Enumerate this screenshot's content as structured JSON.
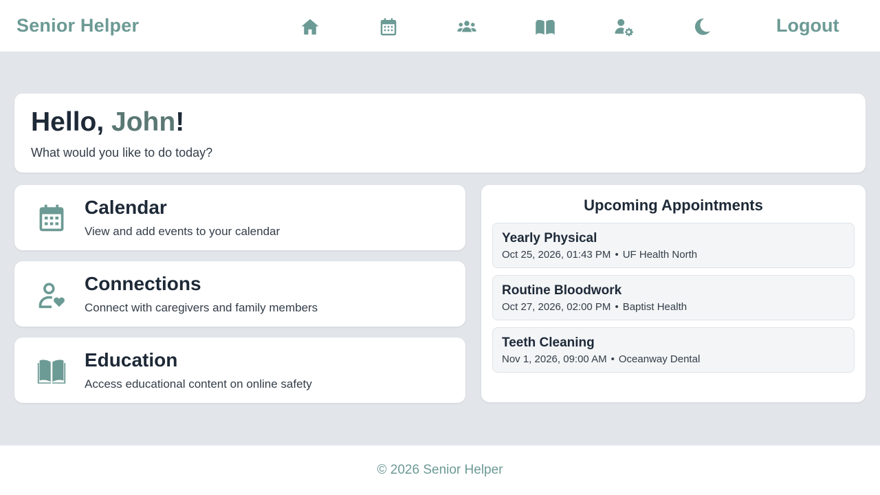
{
  "header": {
    "brand": "Senior Helper",
    "nav_icons": [
      "home-icon",
      "calendar-icon",
      "users-icon",
      "book-icon",
      "user-gear-icon",
      "moon-icon"
    ],
    "logout_label": "Logout"
  },
  "greeting": {
    "hello": "Hello, ",
    "name": "John",
    "suffix": "!",
    "subtitle": "What would you like to do today?"
  },
  "features": [
    {
      "icon": "calendar-icon",
      "title": "Calendar",
      "description": "View and add events to your calendar"
    },
    {
      "icon": "user-heart-icon",
      "title": "Connections",
      "description": "Connect with caregivers and family members"
    },
    {
      "icon": "book-open-icon",
      "title": "Education",
      "description": "Access educational content on online safety"
    }
  ],
  "appointments": {
    "heading": "Upcoming Appointments",
    "separator": "•",
    "items": [
      {
        "title": "Yearly Physical",
        "datetime": "Oct 25, 2026, 01:43 PM",
        "location": "UF Health North"
      },
      {
        "title": "Routine Bloodwork",
        "datetime": "Oct 27, 2026, 02:00 PM",
        "location": "Baptist Health"
      },
      {
        "title": "Teeth Cleaning",
        "datetime": "Nov 1, 2026, 09:00 AM",
        "location": "Oceanway Dental"
      }
    ]
  },
  "footer": {
    "text": "© 2026 Senior Helper"
  },
  "colors": {
    "accent": "#6c9a94",
    "background": "#e2e6eb",
    "card": "#ffffff",
    "text": "#1e2937"
  }
}
